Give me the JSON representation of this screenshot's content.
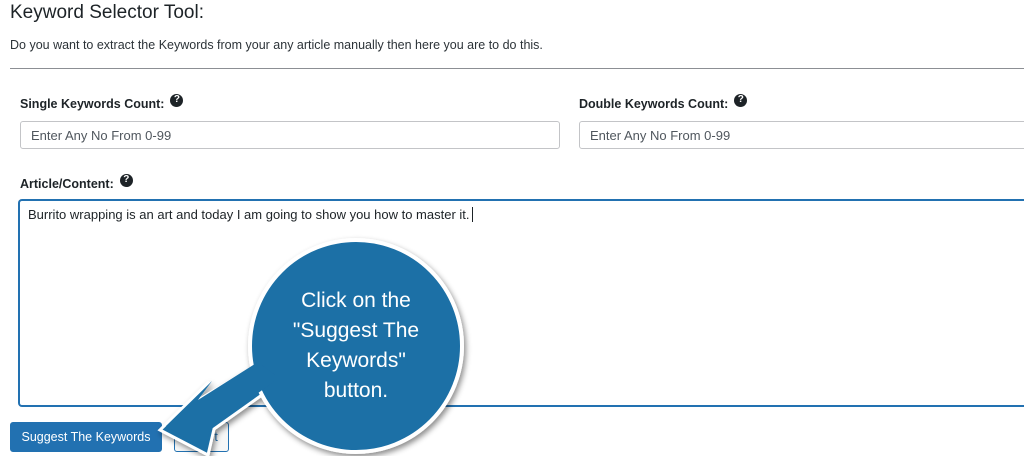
{
  "header": {
    "title": "Keyword Selector Tool:",
    "description": "Do you want to extract the Keywords from your any article manually then here you are to do this."
  },
  "fields": {
    "single": {
      "label": "Single Keywords Count:",
      "placeholder": "Enter Any No From 0-99"
    },
    "double": {
      "label": "Double Keywords Count:",
      "placeholder": "Enter Any No From 0-99"
    },
    "article": {
      "label": "Article/Content:",
      "value": "Burrito wrapping is an art and today I am going to show you how to master it."
    }
  },
  "help_icon": {
    "glyph": "?",
    "icon": "question-circle-icon"
  },
  "buttons": {
    "suggest": "Suggest The Keywords",
    "reset": "Reset"
  },
  "callout": {
    "lines": [
      "Click on the",
      "\"Suggest The",
      "Keywords\"",
      "button."
    ],
    "color": "#1b6fa6"
  },
  "colors": {
    "primary": "#2271b1",
    "text": "#1d2327"
  }
}
